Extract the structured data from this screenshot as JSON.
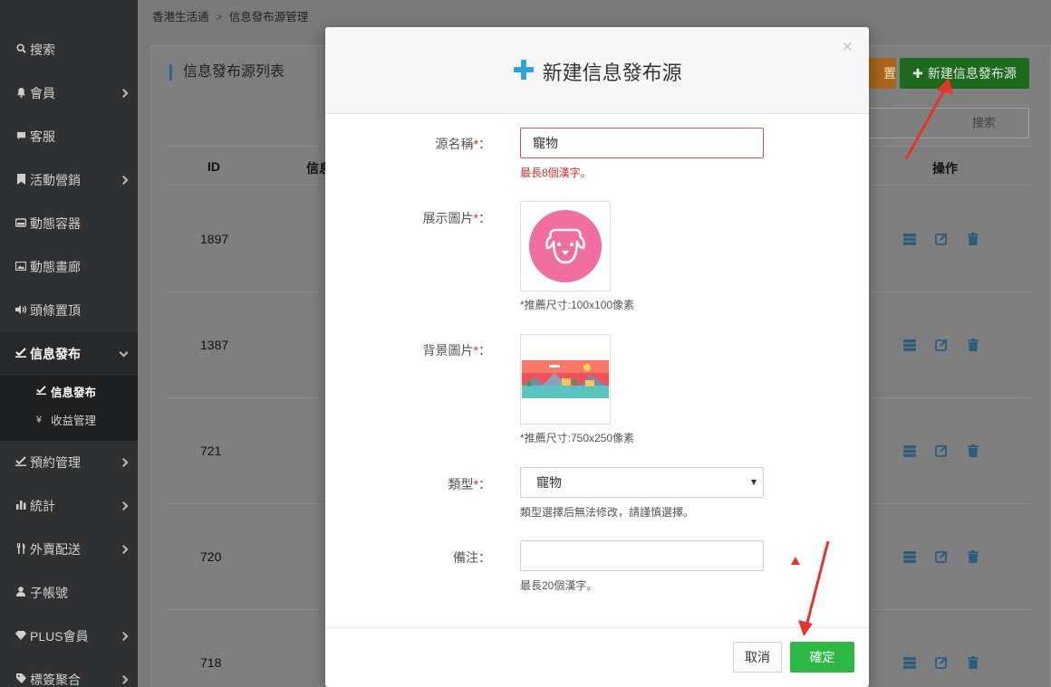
{
  "sidebar": {
    "items": [
      {
        "label": "搜索",
        "icon": "search-icon"
      },
      {
        "label": "會員",
        "icon": "bell-icon"
      },
      {
        "label": "客服",
        "icon": "chat-icon"
      },
      {
        "label": "活動營銷",
        "icon": "bookmark-icon"
      },
      {
        "label": "動態容器",
        "icon": "hdd-icon"
      },
      {
        "label": "動態畫廊",
        "icon": "picture-icon"
      },
      {
        "label": "頭條置頂",
        "icon": "volume-icon"
      },
      {
        "label": "信息發布",
        "icon": "check-icon"
      },
      {
        "label": "預約管理",
        "icon": "check-icon"
      },
      {
        "label": "統計",
        "icon": "bar-chart-icon"
      },
      {
        "label": "外賣配送",
        "icon": "cutlery-icon"
      },
      {
        "label": "子帳號",
        "icon": "user-icon"
      },
      {
        "label": "PLUS會員",
        "icon": "diamond-icon"
      },
      {
        "label": "標簽聚合",
        "icon": "tag-icon"
      }
    ],
    "submenu": [
      {
        "label": "信息發布",
        "icon": "check-icon"
      },
      {
        "label": "收益管理",
        "icon": "yen-icon"
      }
    ]
  },
  "breadcrumb": {
    "home": "香港生活通",
    "separator": ">",
    "current": "信息發布源管理"
  },
  "panel": {
    "title": "信息發布源列表",
    "orange_button_partial": "置",
    "new_button": "新建信息發布源",
    "search_placeholder": "搜索"
  },
  "table": {
    "headers": {
      "id": "ID",
      "info": "信息",
      "actions": "操作"
    },
    "rows": [
      {
        "id": "1897"
      },
      {
        "id": "1387"
      },
      {
        "id": "721"
      },
      {
        "id": "720"
      },
      {
        "id": "718"
      }
    ]
  },
  "modal": {
    "title": "新建信息發布源",
    "close": "×",
    "fields": {
      "name": {
        "label": "源名稱",
        "required": "*",
        "colon": "：",
        "value": "寵物",
        "help": "最長8個漢字。"
      },
      "display_image": {
        "label": "展示圖片",
        "required": "*",
        "colon": "：",
        "help": "*推薦尺寸:100x100像素"
      },
      "bg_image": {
        "label": "背景圖片",
        "required": "*",
        "colon": "：",
        "help": "*推薦尺寸:750x250像素"
      },
      "type": {
        "label": "類型",
        "required": "*",
        "colon": "：",
        "value": "寵物",
        "help": "類型選擇后無法修改，請謹慎選擇。"
      },
      "remark": {
        "label": "備注",
        "colon": "：",
        "value": "",
        "help": "最長20個漢字。"
      }
    },
    "cancel": "取消",
    "confirm": "確定"
  },
  "colors": {
    "accent_blue": "#2aa4dc",
    "confirm_green": "#2db744",
    "error_red": "#d9534f",
    "annotation_red": "#e8332c"
  }
}
